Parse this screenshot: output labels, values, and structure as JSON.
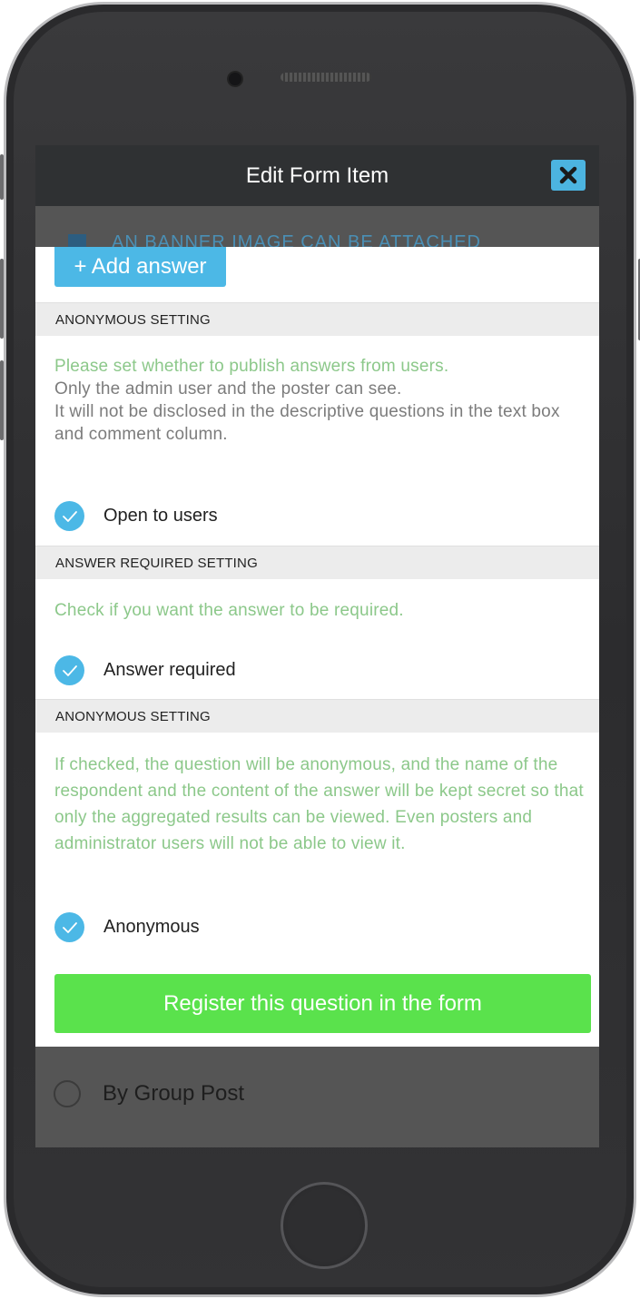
{
  "header": {
    "title": "Edit Form Item"
  },
  "background": {
    "banner_text": "AN BANNER IMAGE CAN BE ATTACHED",
    "radio_label": "By Group Post"
  },
  "modal": {
    "add_answer_label": "+ Add answer",
    "sections": [
      {
        "header": "ANONYMOUS SETTING",
        "desc_green": "Please set whether to publish answers from users.",
        "desc_gray_1": "Only the admin user and the poster can see.",
        "desc_gray_2": "It will not be disclosed in the descriptive questions in the text box and comment column.",
        "checkbox_label": "Open to users"
      },
      {
        "header": "ANSWER REQUIRED SETTING",
        "desc_green": "Check if you want the answer to be required.",
        "checkbox_label": "Answer required"
      },
      {
        "header": "ANONYMOUS SETTING",
        "desc_green": "If checked, the question will be anonymous, and the name of the respondent and the content of the answer will be kept secret so that only the aggregated results can be viewed. Even posters and administrator users will not be able to view it.",
        "checkbox_label": "Anonymous"
      }
    ],
    "register_label": "Register this question in the form"
  },
  "colors": {
    "accent_blue": "#4cb8e6",
    "register_green": "#5ae24c",
    "desc_green": "#8cc88a",
    "topbar": "#2f3133"
  },
  "icons": {
    "close": "close-icon",
    "check": "checkmark-icon"
  }
}
